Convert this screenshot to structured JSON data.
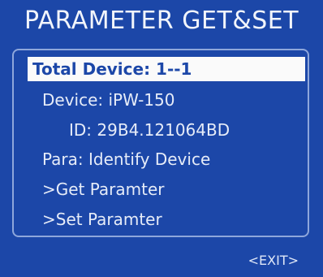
{
  "title": "PARAMETER GET&SET",
  "menu": {
    "total_device": "Total Device: 1--1",
    "device": "Device: iPW-150",
    "id": "ID: 29B4.121064BD",
    "para": "Para: Identify Device",
    "get": ">Get Paramter",
    "set": ">Set Paramter"
  },
  "exit_label": "<EXIT>",
  "colors": {
    "background": "#1c47a8",
    "text": "#e6ecf8",
    "selection": "#fafafa",
    "border": "#8ea7db"
  }
}
